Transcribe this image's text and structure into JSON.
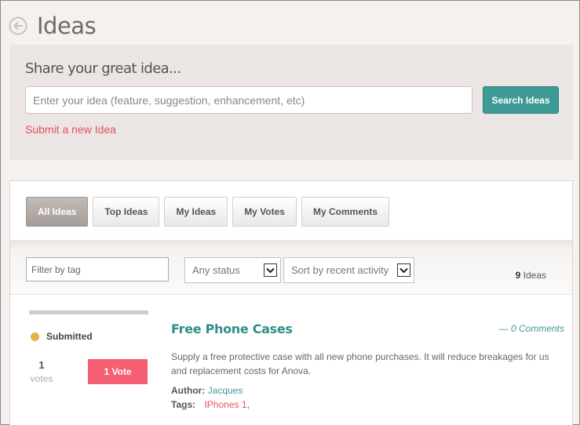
{
  "header": {
    "title": "Ideas",
    "back_icon": "back-arrow-icon"
  },
  "share": {
    "title": "Share your great idea...",
    "input_placeholder": "Enter your idea (feature, suggestion, enhancement, etc)",
    "input_value": "",
    "search_button": "Search Ideas",
    "submit_link": "Submit a new Idea"
  },
  "tabs": [
    {
      "label": "All Ideas",
      "active": true
    },
    {
      "label": "Top Ideas",
      "active": false
    },
    {
      "label": "My Ideas",
      "active": false
    },
    {
      "label": "My Votes",
      "active": false
    },
    {
      "label": "My Comments",
      "active": false
    }
  ],
  "filters": {
    "tag_placeholder": "Filter by tag",
    "status_value": "Any status",
    "sort_value": "Sort by recent activity",
    "count_number": "9",
    "count_label": "Ideas"
  },
  "ideas": [
    {
      "status": "Submitted",
      "status_color": "#e4b246",
      "votes_number": "1",
      "votes_unit": "votes",
      "vote_button": "1 Vote",
      "title": "Free Phone Cases",
      "comments": "— 0 Comments",
      "description": "Supply a free protective case with all new phone purchases. It will reduce breakages for us and replacement costs for Anova.",
      "author_label": "Author:",
      "author": "Jacques",
      "tags_label": "Tags:",
      "tags": [
        "IPhones 1"
      ],
      "tags_suffix": ","
    }
  ],
  "colors": {
    "accent": "#3e9a94",
    "vote": "#f55f73",
    "link": "#e94e64"
  }
}
